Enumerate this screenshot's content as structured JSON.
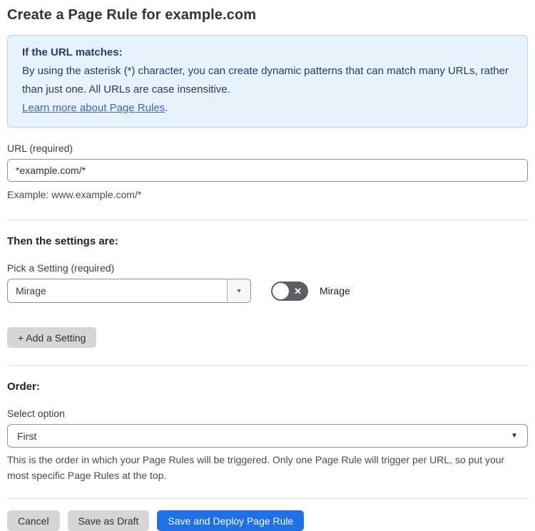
{
  "page": {
    "title": "Create a Page Rule for example.com"
  },
  "info_box": {
    "heading": "If the URL matches:",
    "body": "By using the asterisk (*) character, you can create dynamic patterns that can match many URLs, rather than just one. All URLs are case insensitive.",
    "link_label": "Learn more about Page Rules",
    "link_suffix": "."
  },
  "url_section": {
    "label": "URL (required)",
    "value": "*example.com/*",
    "helper": "Example: www.example.com/*"
  },
  "settings_section": {
    "heading": "Then the settings are:",
    "picker_label": "Pick a Setting (required)",
    "selected_setting": "Mirage",
    "toggle_label": "Mirage",
    "toggle_state": "off",
    "add_button_label": "+ Add a Setting"
  },
  "order_section": {
    "heading": "Order:",
    "label": "Select option",
    "selected_option": "First",
    "helper": "This is the order in which your Page Rules will be triggered. Only one Page Rule will trigger per URL, so put your most specific Page Rules at the top."
  },
  "footer": {
    "cancel_label": "Cancel",
    "save_draft_label": "Save as Draft",
    "save_deploy_label": "Save and Deploy Page Rule"
  },
  "icons": {
    "dropdown_arrow": "▼",
    "toggle_x": "✕"
  },
  "colors": {
    "info_bg": "#e9f1fb",
    "info_border": "#b6d3f0",
    "info_text": "#1d3f72",
    "link": "#2c6ecb",
    "primary_button": "#1f6fe5",
    "toggle_off": "#5b5f63",
    "gray_button": "#d6d6d6"
  }
}
